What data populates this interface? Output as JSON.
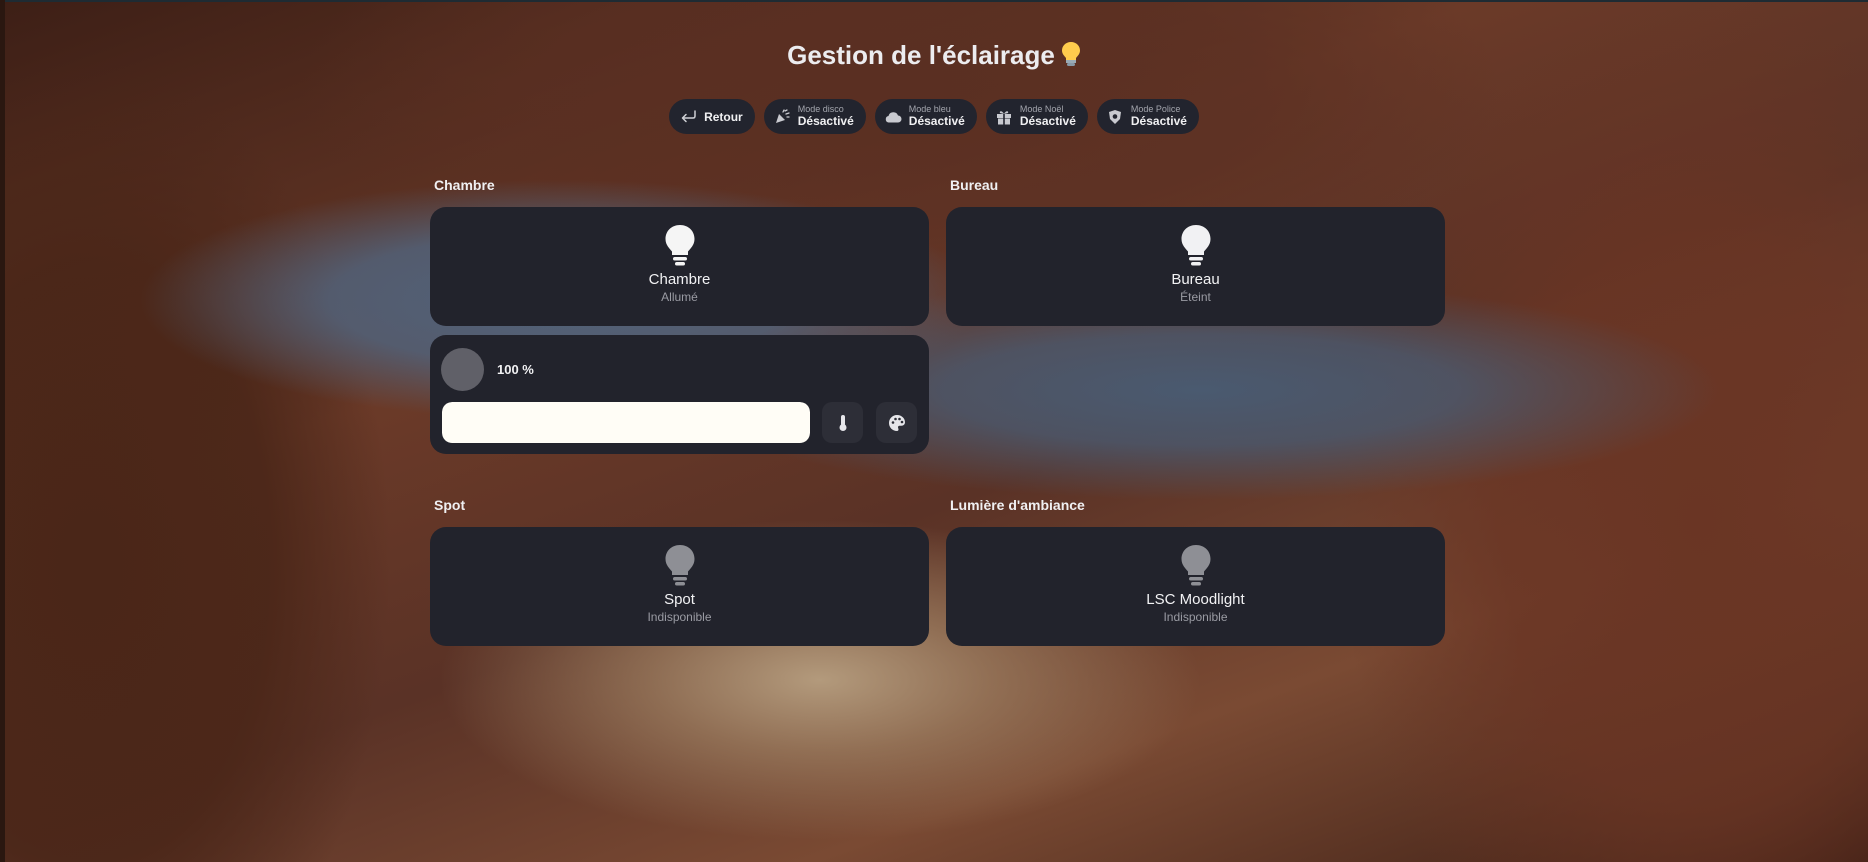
{
  "title": "Gestion de l'éclairage",
  "header_chips": [
    {
      "icon": "arrow-return-icon",
      "label": "Retour"
    },
    {
      "icon": "party-popper-icon",
      "small": "Mode disco",
      "state": "Désactivé"
    },
    {
      "icon": "cloud-icon",
      "small": "Mode bleu",
      "state": "Désactivé"
    },
    {
      "icon": "gift-icon",
      "small": "Mode Noël",
      "state": "Désactivé"
    },
    {
      "icon": "police-badge-icon",
      "small": "Mode Police",
      "state": "Désactivé"
    }
  ],
  "sections": [
    {
      "label": "Chambre",
      "light": {
        "name": "Chambre",
        "state": "Allumé",
        "icon": "lightbulb-icon",
        "on": true
      }
    },
    {
      "label": "Bureau",
      "light": {
        "name": "Bureau",
        "state": "Éteint",
        "icon": "lightbulb-icon",
        "on": false
      }
    },
    {
      "label": "Spot",
      "light": {
        "name": "Spot",
        "state": "Indisponible",
        "icon": "lightbulb-icon",
        "on": false
      }
    },
    {
      "label": "Lumière d'ambiance",
      "light": {
        "name": "LSC Moodlight",
        "state": "Indisponible",
        "icon": "lightbulb-icon",
        "on": false
      }
    }
  ],
  "brightness": {
    "label": "100 %",
    "value": 100
  },
  "control_buttons": [
    "thermometer-icon",
    "palette-icon"
  ],
  "colors": {
    "card": "#22232c",
    "bulb_on": "#f5f5f5",
    "bulb_off": "#8e8f95",
    "slider_fill": "#fffdf6"
  }
}
